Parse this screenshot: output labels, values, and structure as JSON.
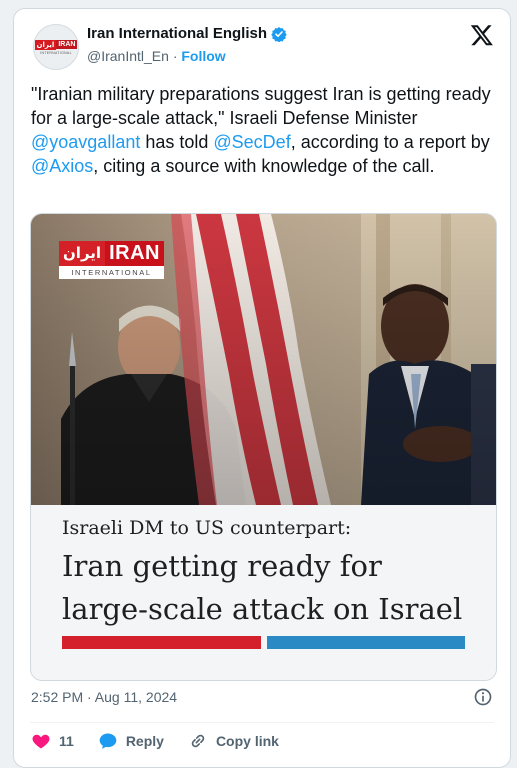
{
  "account": {
    "name": "Iran International English",
    "handle": "@IranIntl_En",
    "separator": "·",
    "follow_label": "Follow",
    "avatar_logo_fa": "ایران",
    "avatar_logo_en": "IRAN",
    "avatar_logo_sub": "INTERNATIONAL"
  },
  "tweet": {
    "text_1": "\"Iranian military preparations suggest Iran is getting ready for a large-scale attack,\" Israeli Defense Minister ",
    "mention_1": "@yoavgallant",
    "text_2": " has told ",
    "mention_2": "@SecDef",
    "text_3": ", according to a report by ",
    "mention_3": "@Axios",
    "text_4": ", citing a source with knowledge of the call."
  },
  "media": {
    "logo_fa": "ایران",
    "logo_en": "IRAN",
    "logo_sub": "INTERNATIONAL",
    "subhead": "Israeli DM to US counterpart:",
    "headline_1": "Iran getting ready for",
    "headline_2": "large-scale attack on Israel"
  },
  "meta": {
    "timestamp": "2:52 PM · Aug 11, 2024"
  },
  "actions": {
    "like_count": "11",
    "reply_label": "Reply",
    "copy_label": "Copy link"
  },
  "icons": {
    "verified": "verified-badge-icon",
    "x_logo": "x-logo-icon",
    "info": "info-icon",
    "like": "heart-icon",
    "reply": "reply-bubble-icon",
    "copy": "link-icon"
  },
  "colors": {
    "accent": "#1d9bf0",
    "like": "#f91880",
    "headline_bar_red": "#d41f2c",
    "headline_bar_blue": "#2a8ac3"
  }
}
